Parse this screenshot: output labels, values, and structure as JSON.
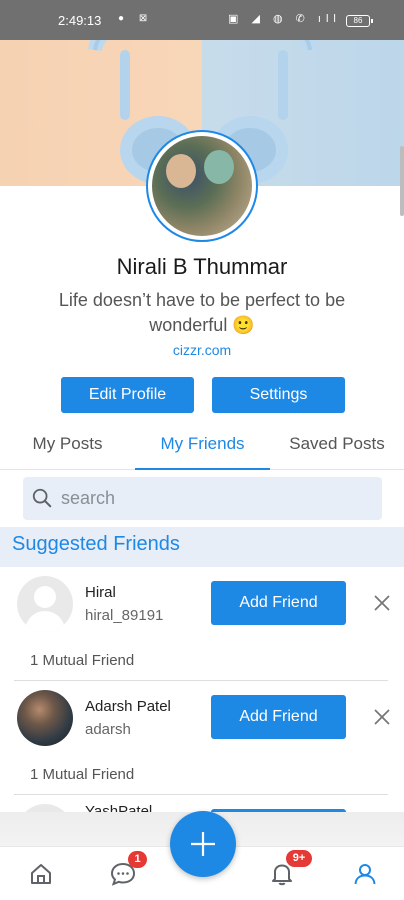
{
  "status_bar": {
    "time": "2:49:13",
    "battery": "86"
  },
  "profile": {
    "name": "Nirali B Thummar",
    "bio": "Life doesn’t have to be perfect to be wonderful 🙂",
    "website": "cizzr.com",
    "edit_button": "Edit Profile",
    "settings_button": "Settings"
  },
  "tabs": [
    {
      "label": "My Posts",
      "active": false
    },
    {
      "label": "My Friends",
      "active": true
    },
    {
      "label": "Saved Posts",
      "active": false
    }
  ],
  "search": {
    "placeholder": "search"
  },
  "suggested": {
    "title": "Suggested Friends",
    "friends": [
      {
        "name": "Hiral",
        "username": "hiral_89191",
        "button": "Add Friend",
        "mutual": "1 Mutual Friend",
        "avatar": "default-avatar"
      },
      {
        "name": "Adarsh Patel",
        "username": "adarsh",
        "button": "Add Friend",
        "mutual": "1 Mutual Friend",
        "avatar": "photo"
      },
      {
        "name": "YashPatel",
        "username": "",
        "button": "",
        "mutual": "",
        "avatar": "default-avatar"
      }
    ]
  },
  "bottom_nav": {
    "items": [
      {
        "icon": "home-icon"
      },
      {
        "icon": "chat-icon",
        "badge": "1"
      },
      {
        "icon": "plus-icon"
      },
      {
        "icon": "bell-icon",
        "badge": "9+"
      },
      {
        "icon": "profile-icon",
        "active": true
      }
    ]
  },
  "colors": {
    "accent": "#1e88e5",
    "badge": "#e53935",
    "section_bg": "#e8eef7"
  }
}
